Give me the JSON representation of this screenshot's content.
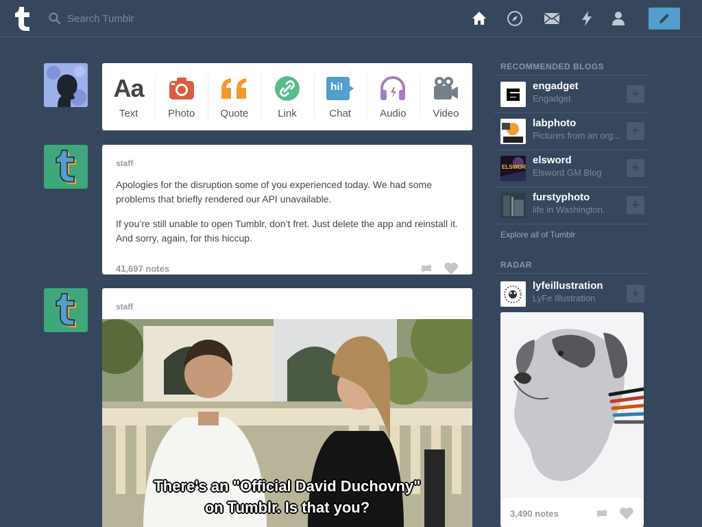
{
  "header": {
    "search_placeholder": "Search Tumblr",
    "nav": [
      "home-icon",
      "explore-icon",
      "inbox-icon",
      "activity-icon",
      "account-icon"
    ],
    "compose_icon": "pencil-icon"
  },
  "post_types": [
    {
      "label": "Text",
      "icon": "text-icon",
      "glyph": "Aa",
      "color": "#444444"
    },
    {
      "label": "Photo",
      "icon": "camera-icon",
      "color": "#d95e40"
    },
    {
      "label": "Quote",
      "icon": "quote-icon",
      "color": "#f2992e"
    },
    {
      "label": "Link",
      "icon": "link-icon",
      "color": "#56bc8a"
    },
    {
      "label": "Chat",
      "icon": "chat-icon",
      "glyph": "hi!",
      "color": "#529ecc"
    },
    {
      "label": "Audio",
      "icon": "headphones-icon",
      "color": "#a77dc2"
    },
    {
      "label": "Video",
      "icon": "video-camera-icon",
      "color": "#748089"
    }
  ],
  "posts": [
    {
      "blog": "staff",
      "paragraphs": [
        "Apologies for the disruption some of you experienced today. We had some problems that briefly rendered our API unavailable.",
        "If you’re still unable to open Tumblr, don’t fret. Just delete the app and reinstall it. And sorry, again, for this hiccup."
      ],
      "notes": "41,697 notes"
    },
    {
      "blog": "staff",
      "caption_line1": "There's an \"Official David Duchovny\"",
      "caption_line2": "on Tumblr. Is that you?"
    }
  ],
  "sidebar": {
    "recommended_title": "RECOMMENDED BLOGS",
    "blogs": [
      {
        "name": "engadget",
        "title": "Engadget"
      },
      {
        "name": "labphoto",
        "title": "Pictures from an org..."
      },
      {
        "name": "elsword",
        "title": "Elsword GM Blog",
        "avatar_text": "ELSWORD"
      },
      {
        "name": "furstyphoto",
        "title": "life in Washington."
      }
    ],
    "follow_label": "+",
    "explore": "Explore all of Tumblr",
    "radar_title": "RADAR",
    "radar": {
      "name": "lyfeillustration",
      "title": "LyFe Illustration",
      "notes": "3,490 notes"
    }
  },
  "colors": {
    "background": "#36465d",
    "accent": "#529ecc"
  }
}
